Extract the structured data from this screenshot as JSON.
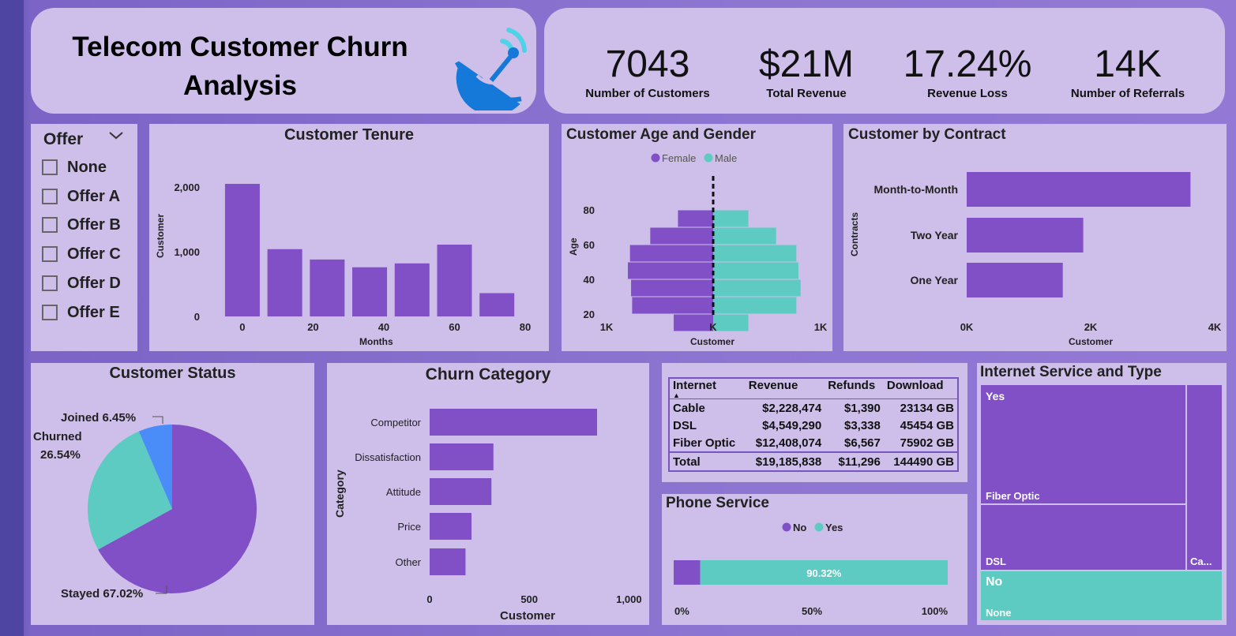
{
  "header": {
    "title_line1": "Telecom Customer Churn",
    "title_line2": "Analysis",
    "icon": "satellite-dish-icon"
  },
  "kpis": [
    {
      "value": "7043",
      "label": "Number of Customers"
    },
    {
      "value": "$21M",
      "label": "Total Revenue"
    },
    {
      "value": "17.24%",
      "label": "Revenue Loss"
    },
    {
      "value": "14K",
      "label": "Number of Referrals"
    }
  ],
  "slicer": {
    "title": "Offer",
    "items": [
      "None",
      "Offer A",
      "Offer B",
      "Offer C",
      "Offer D",
      "Offer E"
    ]
  },
  "colors": {
    "purple": "#8150c6",
    "teal": "#5ecbc3",
    "blue": "#4a8cf8",
    "panel": "#cdbfe9"
  },
  "chart_data": [
    {
      "id": "tenure",
      "type": "bar",
      "title": "Customer Tenure",
      "xlabel": "Months",
      "ylabel": "Customer",
      "x": [
        0,
        10,
        20,
        30,
        40,
        50,
        60,
        70
      ],
      "values": [
        2050,
        1040,
        880,
        760,
        820,
        1110,
        360
      ],
      "x_centers": [
        0,
        12,
        24,
        36,
        48,
        60,
        72
      ],
      "xticks": [
        "0",
        "20",
        "40",
        "60",
        "80"
      ],
      "xtick_values": [
        0,
        20,
        40,
        60,
        80
      ],
      "yticks": [
        "0",
        "1,000",
        "2,000"
      ],
      "ytick_values": [
        0,
        1000,
        2000
      ],
      "xlim": [
        -4,
        80
      ],
      "ylim": [
        0,
        2050
      ]
    },
    {
      "id": "age_gender",
      "type": "bar",
      "title": "Customer Age and Gender",
      "xlabel": "Customer",
      "ylabel": "Age",
      "legend": [
        "Female",
        "Male"
      ],
      "age_bands": [
        80,
        70,
        60,
        50,
        40,
        30,
        20,
        10
      ],
      "age_centers": [
        75,
        65,
        55,
        45,
        35,
        25,
        15
      ],
      "female": [
        330,
        590,
        780,
        800,
        770,
        760,
        370
      ],
      "male": [
        330,
        590,
        780,
        800,
        820,
        780,
        330
      ],
      "yticks": [
        "20",
        "40",
        "60",
        "80"
      ],
      "ytick_values": [
        20,
        40,
        60,
        80
      ],
      "xticks": [
        "1K",
        "K",
        "1K"
      ],
      "xlim": [
        -1000,
        1000
      ]
    },
    {
      "id": "contract",
      "type": "bar",
      "title": "Customer by Contract",
      "xlabel": "Customer",
      "ylabel": "Contracts",
      "categories": [
        "Month-to-Month",
        "Two Year",
        "One Year"
      ],
      "values": [
        3610,
        1880,
        1550
      ],
      "xticks": [
        "0K",
        "2K",
        "4K"
      ],
      "xtick_values": [
        0,
        2000,
        4000
      ],
      "xlim": [
        0,
        4000
      ]
    },
    {
      "id": "status",
      "type": "pie",
      "title": "Customer Status",
      "labels": [
        "Stayed",
        "Churned",
        "Joined"
      ],
      "values": [
        67.02,
        26.54,
        6.45
      ],
      "display": [
        "Stayed 67.02%",
        "Churned",
        "26.54%",
        "Joined 6.45%"
      ]
    },
    {
      "id": "churn_category",
      "type": "bar",
      "title": "Churn Category",
      "xlabel": "Customer",
      "ylabel": "Category",
      "categories": [
        "Competitor",
        "Dissatisfaction",
        "Attitude",
        "Price",
        "Other"
      ],
      "values": [
        840,
        320,
        310,
        210,
        180
      ],
      "xticks": [
        "0",
        "500",
        "1,000"
      ],
      "xtick_values": [
        0,
        500,
        1000
      ],
      "xlim": [
        0,
        1050
      ]
    },
    {
      "id": "phone_service",
      "type": "bar",
      "title": "Phone Service",
      "legend": [
        "No",
        "Yes"
      ],
      "values": [
        9.68,
        90.32
      ],
      "yes_label": "90.32%",
      "xticks": [
        "0%",
        "50%",
        "100%"
      ]
    },
    {
      "id": "internet_treemap",
      "type": "table",
      "title": "Internet Service and Type",
      "labels": [
        "Yes",
        "Fiber Optic",
        "DSL",
        "Ca...",
        "No",
        "None"
      ]
    }
  ],
  "internet_table": {
    "headers": [
      "Internet",
      "Revenue",
      "Refunds",
      "Download"
    ],
    "rows": [
      [
        "Cable",
        "$2,228,474",
        "$1,390",
        "23134 GB"
      ],
      [
        "DSL",
        "$4,549,290",
        "$3,338",
        "45454 GB"
      ],
      [
        "Fiber Optic",
        "$12,408,074",
        "$6,567",
        "75902 GB"
      ]
    ],
    "total": [
      "Total",
      "$19,185,838",
      "$11,296",
      "144490 GB"
    ]
  }
}
